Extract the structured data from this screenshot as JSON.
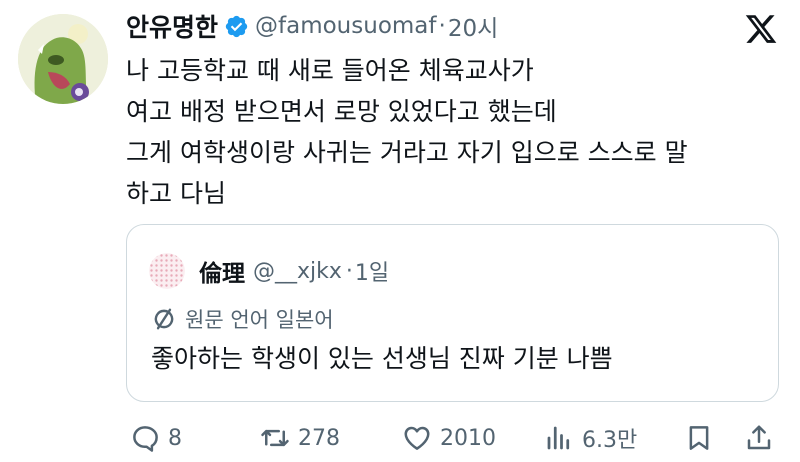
{
  "tweet": {
    "author_name": "안유명한",
    "handle": "@famousuomaf",
    "separator": "·",
    "time": "20시",
    "lines": [
      "나 고등학교 때 새로 들어온 체육교사가",
      "여고 배정 받으면서 로망 있었다고 했는데",
      "그게 여학생이랑 사귀는 거라고 자기 입으로 스스로 말",
      "하고 다님"
    ]
  },
  "quoted": {
    "author_name": "倫理",
    "handle": "@__xjkx",
    "separator": "·",
    "time": "1일",
    "translate_label": "원문 언어 일본어",
    "text": "좋아하는 학생이 있는 선생님 진짜 기분 나쁨"
  },
  "actions": {
    "replies": "8",
    "reposts": "278",
    "likes": "2010",
    "views": "6.3만"
  },
  "colors": {
    "verified": "#1d9bf0",
    "text_primary": "#0f1419",
    "text_secondary": "#536471",
    "border": "#cfd9de"
  },
  "icons": [
    "verified-badge-icon",
    "x-logo-icon",
    "translate-icon",
    "reply-icon",
    "repost-icon",
    "like-icon",
    "views-icon",
    "bookmark-icon",
    "share-icon"
  ]
}
